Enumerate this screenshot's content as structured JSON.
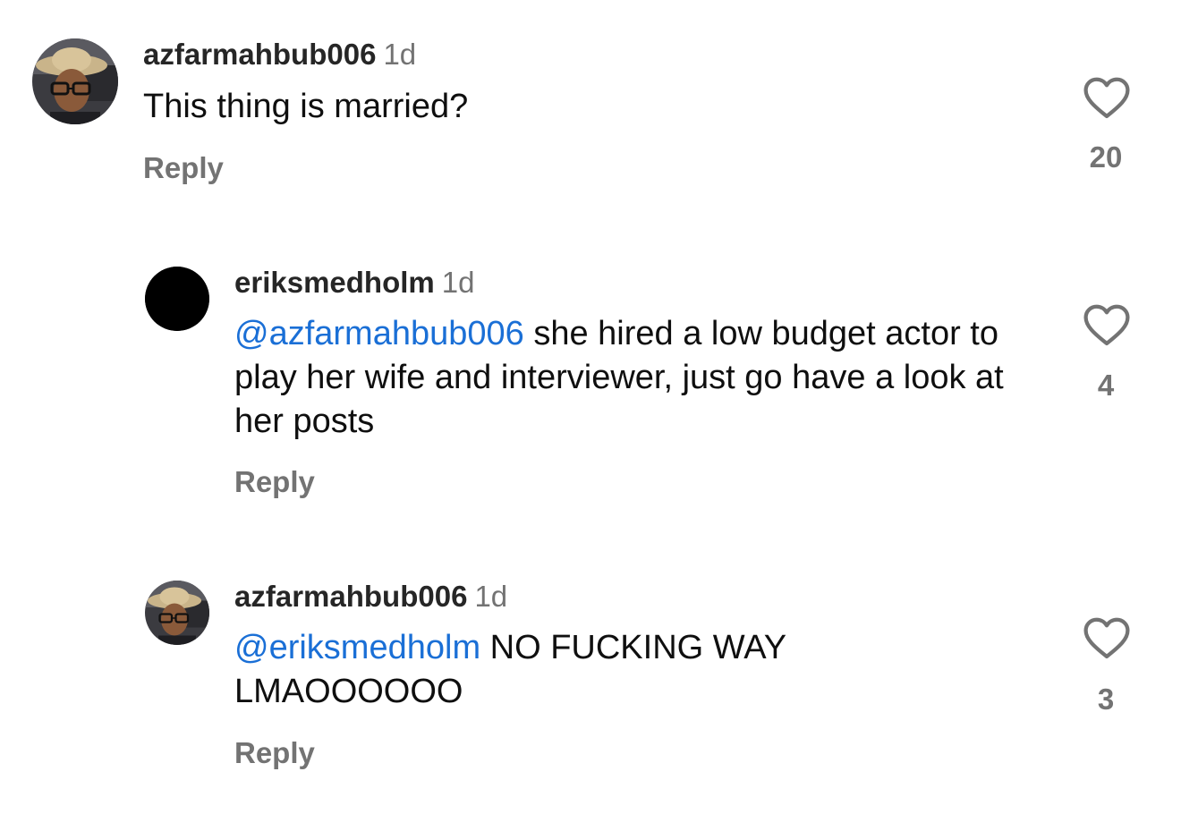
{
  "comments": [
    {
      "username": "azfarmahbub006",
      "time": "1d",
      "text": "This thing is married?",
      "reply_label": "Reply",
      "likes": "20",
      "avatar": "user-photo-avatar"
    },
    {
      "username": "eriksmedholm",
      "time": "1d",
      "mention": "@azfarmahbub006",
      "text": " she hired a low budget actor to play her wife and interviewer, just go have a look at her posts",
      "reply_label": "Reply",
      "likes": "4",
      "avatar": "black-circle-avatar"
    },
    {
      "username": "azfarmahbub006",
      "time": "1d",
      "mention": "@eriksmedholm",
      "text": " NO FUCKING WAY LMAOOOOOO",
      "reply_label": "Reply",
      "likes": "3",
      "avatar": "user-photo-avatar"
    }
  ],
  "colors": {
    "mention": "#1a6fd6",
    "secondary_text": "#737373",
    "username": "#262626"
  },
  "icons": {
    "like": "heart-outline-icon"
  }
}
